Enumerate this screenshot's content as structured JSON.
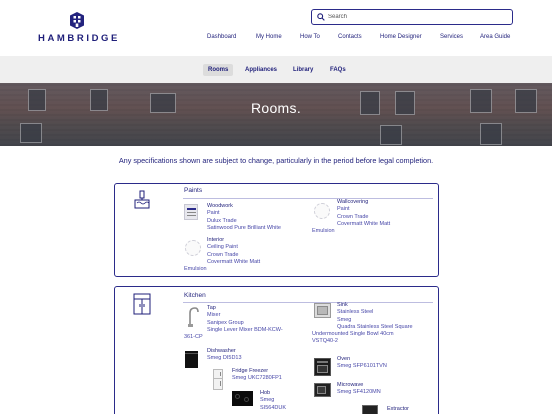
{
  "brand": {
    "name": "HAMBRIDGE"
  },
  "search": {
    "placeholder": "Search"
  },
  "nav": [
    "Dashboard",
    "My Home",
    "How To",
    "Contacts",
    "Home Designer",
    "Services",
    "Area Guide"
  ],
  "subnav": {
    "items": [
      "Rooms",
      "Appliances",
      "Library",
      "FAQs"
    ],
    "active": "Rooms"
  },
  "hero": {
    "title": "Rooms."
  },
  "notice": "Any specifications shown are subject to change, particularly in the period before legal completion.",
  "paints": {
    "title": "Paints",
    "woodwork": {
      "name": "Woodwork",
      "line1": "Paint",
      "line2": "Dulux Trade",
      "line3": "Satinwood Pure Brilliant White"
    },
    "wallcovering": {
      "name": "Wallcovering",
      "line1": "Paint",
      "line2": "Crown Trade",
      "line3": "Covermatt White Matt",
      "line4": "Emulsion"
    },
    "interior": {
      "name": "Interior",
      "line1": "Ceiling Paint",
      "line2": "Crown Trade",
      "line3": "Covermatt White Matt",
      "line4": "Emulsion"
    }
  },
  "kitchen": {
    "title": "Kitchen",
    "tap": {
      "name": "Tap",
      "line1": "Mixer",
      "line2": "Sanipex Group",
      "line3": "Single Lever Mixer BDM-KCW-",
      "line4": "361-CP"
    },
    "sink": {
      "name": "Sink",
      "line1": "Stainless Steel",
      "line2": "Smeg",
      "line3": "Quadra Stainless Steel Square",
      "line4": "Undermounted Single Bowl 40cm",
      "line5": "VSTQ40-2"
    },
    "dishwasher": {
      "name": "Dishwasher",
      "line1": "Smeg DI5D13"
    },
    "oven": {
      "name": "Oven",
      "line1": "Smeg SFP6101TVN"
    },
    "fridge": {
      "name": "Fridge Freezer",
      "line1": "Smeg UKC7280FP1"
    },
    "microwave": {
      "name": "Microwave",
      "line1": "Smeg SF4120MN"
    },
    "hob": {
      "name": "Hob",
      "line1": "Smeg",
      "line2": "SI564DUK"
    },
    "extractor": {
      "name": "Extractor"
    }
  },
  "colors": {
    "brand": "#1f1f7a",
    "border": "#2b2b8a",
    "subnav_bg": "#efefef"
  }
}
